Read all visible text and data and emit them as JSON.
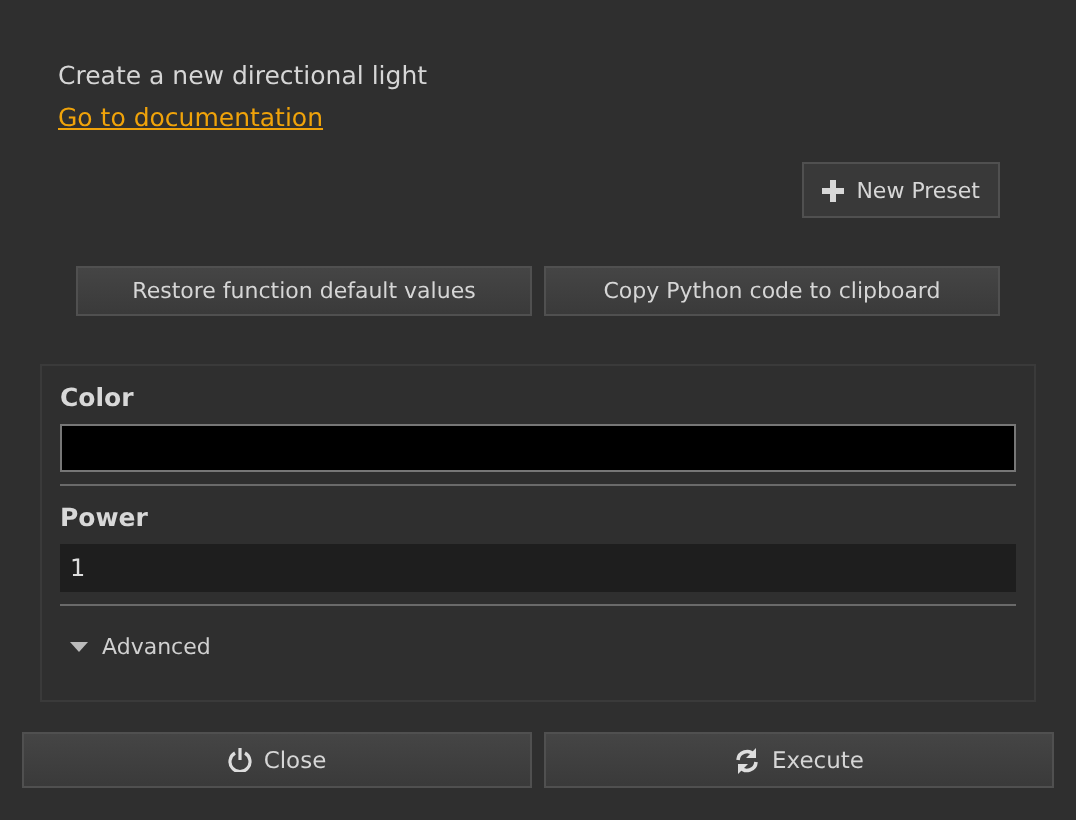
{
  "description": "Create a new directional light",
  "doc_link": "Go to documentation",
  "new_preset_button": "New Preset",
  "action_buttons": [
    "Restore function default values",
    "Copy Python code to clipboard"
  ],
  "parameters": [
    {
      "kind": "color",
      "label": "Color",
      "color": "#000000"
    },
    {
      "kind": "number",
      "label": "Power",
      "value": "1"
    }
  ],
  "advanced": {
    "label": "Advanced",
    "expanded": true
  },
  "footer_buttons": [
    {
      "kind": "close",
      "label": "Close"
    },
    {
      "kind": "execute",
      "label": "Execute"
    }
  ]
}
